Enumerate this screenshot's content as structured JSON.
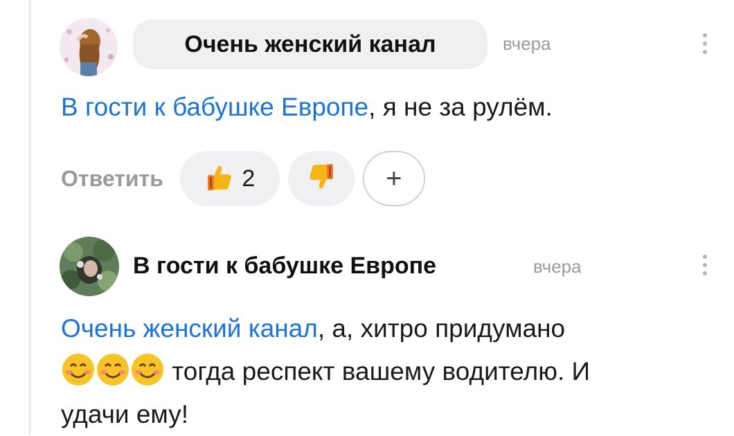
{
  "comments": [
    {
      "author": "Очень женский канал",
      "time": "вчера",
      "mention": "В гости к бабушке Европе",
      "text": ", я не за рулём.",
      "reply_label": "Ответить",
      "likes": "2"
    },
    {
      "author": "В гости к бабушке Европе",
      "time": "вчера",
      "mention": "Очень женский канал",
      "text_line1": ", а, хитро придумано",
      "text_line2": " тогда респект вашему водителю. И",
      "text_line3": "удачи ему!"
    }
  ],
  "icons": {
    "like": "thumbs-up-icon",
    "dislike": "thumbs-down-icon",
    "add_reaction": "plus-icon",
    "more": "kebab-menu-icon",
    "smiley": "smiling-face-icon"
  },
  "colors": {
    "mention": "#1a73d6",
    "chip_bg": "#f0f0f2",
    "muted": "#9a9a9a"
  },
  "add_reaction_label": "+"
}
